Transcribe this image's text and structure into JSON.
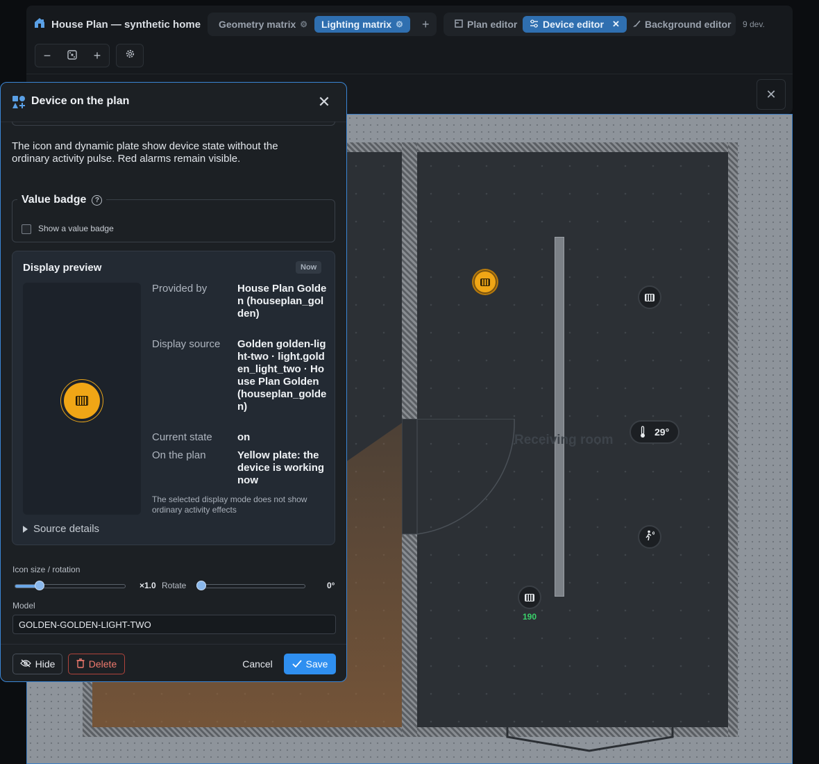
{
  "header": {
    "title": "House Plan — synthetic home",
    "tabs": [
      {
        "label": "Geometry matrix"
      },
      {
        "label": "Lighting matrix"
      }
    ],
    "add_tab": "+",
    "editors": [
      {
        "label": "Plan editor"
      },
      {
        "label": "Device editor"
      },
      {
        "label": "Background editor"
      }
    ],
    "device_count": "9 dev.",
    "zoom_out": "−",
    "zoom_in": "+"
  },
  "plan": {
    "room_label": "Receiving room",
    "temperature": "29°",
    "sensor_value": "190"
  },
  "modal": {
    "title": "Device on the plan",
    "info": "The icon and dynamic plate show device state without the ordinary activity pulse. Red alarms remain visible.",
    "value_badge": {
      "legend": "Value badge",
      "help": "?",
      "checkbox_label": "Show a value badge",
      "checked": false
    },
    "preview": {
      "title": "Display preview",
      "chip": "Now",
      "rows": [
        {
          "label": "Provided by",
          "value": "House Plan Golden (houseplan_golden)"
        },
        {
          "label": "Display source",
          "value": "Golden golden-light-two · light.golden_light_two · House Plan Golden (houseplan_golden)"
        },
        {
          "label": "Current state",
          "value": "on"
        },
        {
          "label": "On the plan",
          "value": "Yellow plate: the device is working now"
        }
      ],
      "note": "The selected display mode does not show ordinary activity effects",
      "source_details": "Source details"
    },
    "icon_size": {
      "label": "Icon size / rotation",
      "value": "×1.0",
      "fraction": 0.2,
      "rotate_label": "Rotate",
      "rotate_value": "0°",
      "rotate_fraction": 0.0
    },
    "model": {
      "label": "Model",
      "value": "GOLDEN-GOLDEN-LIGHT-TWO"
    },
    "footer": {
      "hide": "Hide",
      "delete": "Delete",
      "cancel": "Cancel",
      "save": "Save"
    }
  },
  "colors": {
    "accent": "#2f8ff0",
    "device_on": "#f0a616",
    "danger": "#f07a6e",
    "sensor_value": "#3ad36b"
  }
}
